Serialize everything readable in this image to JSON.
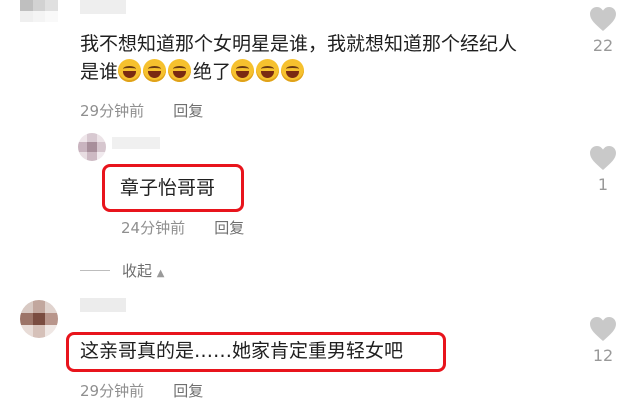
{
  "comments": [
    {
      "text_line1": "我不想知道那个女明星是谁，我就想知道那个经纪人",
      "text_line2_prefix": "是谁",
      "text_line2_suffix": "绝了",
      "time": "29分钟前",
      "reply_label": "回复",
      "likes": "22"
    },
    {
      "text": "章子怡哥哥",
      "time": "24分钟前",
      "reply_label": "回复",
      "likes": "1"
    },
    {
      "text": "这亲哥真的是……她家肯定重男轻女吧",
      "time": "29分钟前",
      "reply_label": "回复",
      "likes": "12"
    }
  ],
  "collapse": {
    "label": "收起",
    "arrow": "▲"
  },
  "icons": {
    "like": "heart-icon",
    "emoji": "laughing-emoji-icon"
  },
  "colors": {
    "highlight_box": "#e8141c",
    "heart": "#c9c9c9",
    "meta_text": "#8f8f8f"
  }
}
